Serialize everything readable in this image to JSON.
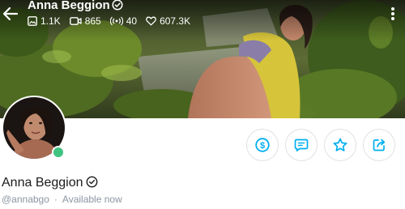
{
  "header": {
    "title": "Anna Beggion",
    "stats": {
      "photos": "1.1K",
      "videos": "865",
      "streams": "40",
      "likes": "607.3K"
    }
  },
  "profile": {
    "display_name": "Anna Beggion",
    "username": "@annabgo",
    "separator": "·",
    "status": "Available now",
    "online": true
  },
  "actions": {
    "tip": "dollar-icon",
    "message": "chat-icon",
    "favorite": "star-icon",
    "share": "share-icon"
  },
  "colors": {
    "accent": "#00aff0",
    "online": "#3fc380",
    "muted_text": "#8a96a3"
  }
}
